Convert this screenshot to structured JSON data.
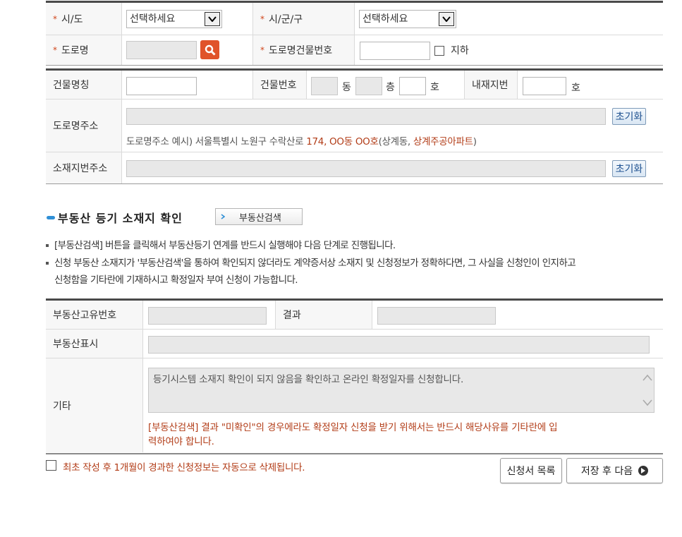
{
  "address_form": {
    "province_label": "시/도",
    "province_value": "선택하세요",
    "city_label": "시/군/구",
    "city_value": "선택하세요",
    "road_label": "도로명",
    "building_no_label": "도로명건물번호",
    "basement_label": "지하",
    "required_mark": "*"
  },
  "building": {
    "name_label": "건물명칭",
    "number_label": "건물번호",
    "dong": "동",
    "floor": "층",
    "ho": "호",
    "inner_lot_label": "내재지번",
    "inner_lot_ho": "호",
    "road_address_label": "도로명주소",
    "reset_label": "초기화",
    "example_prefix": "도로명주소 예시) 서울특별시 노원구 수락산로 ",
    "example_red1": "174, OO동 OO호",
    "example_mid": "(상계동, ",
    "example_red2": "상계주공아파트",
    "example_suffix": ")",
    "lot_address_label": "소재지번주소"
  },
  "registry": {
    "section_title": "부동산 등기 소재지 확인",
    "search_button": "부동산검색",
    "note1": "[부동산검색] 버튼을 클릭해서 부동산등기 연계를 반드시 실행해야 다음 단계로 진행됩니다.",
    "note2_line1": "신청 부동산 소재지가 '부동산검색'을 통하여 확인되지 않더라도 계약증서상 소재지 및 신청정보가 정확하다면, 그 사실을 신청인이 인지하고",
    "note2_line2": "신청함을 기타란에 기재하시고 확정일자 부여 신청이 가능합니다.",
    "id_label": "부동산고유번호",
    "result_label": "결과",
    "display_label": "부동산표시",
    "etc_label": "기타",
    "etc_text": "등기시스템 소재지 확인이 되지 않음을 확인하고 온라인 확정일자를 신청합니다.",
    "etc_warning_line1": "[부동산검색] 결과 \"미확인\"의 경우에라도 확정일자 신청을 받기 위해서는 반드시 해당사유를 기타란에 입",
    "etc_warning_line2": "력하여야 합니다."
  },
  "footer": {
    "auto_delete_note": "최초 작성 후 1개월이 경과한 신청정보는 자동으로 삭제됩니다.",
    "list_button": "신청서 목록",
    "save_next_button": "저장 후 다음"
  },
  "colors": {
    "accent_red": "#b23c17",
    "search_icon_bg": "#e0532a",
    "bullet_blue": "#2f8fd6"
  },
  "icons": [
    "search-icon",
    "chevron-down-icon",
    "arrow-right-icon",
    "circle-arrow-icon"
  ]
}
